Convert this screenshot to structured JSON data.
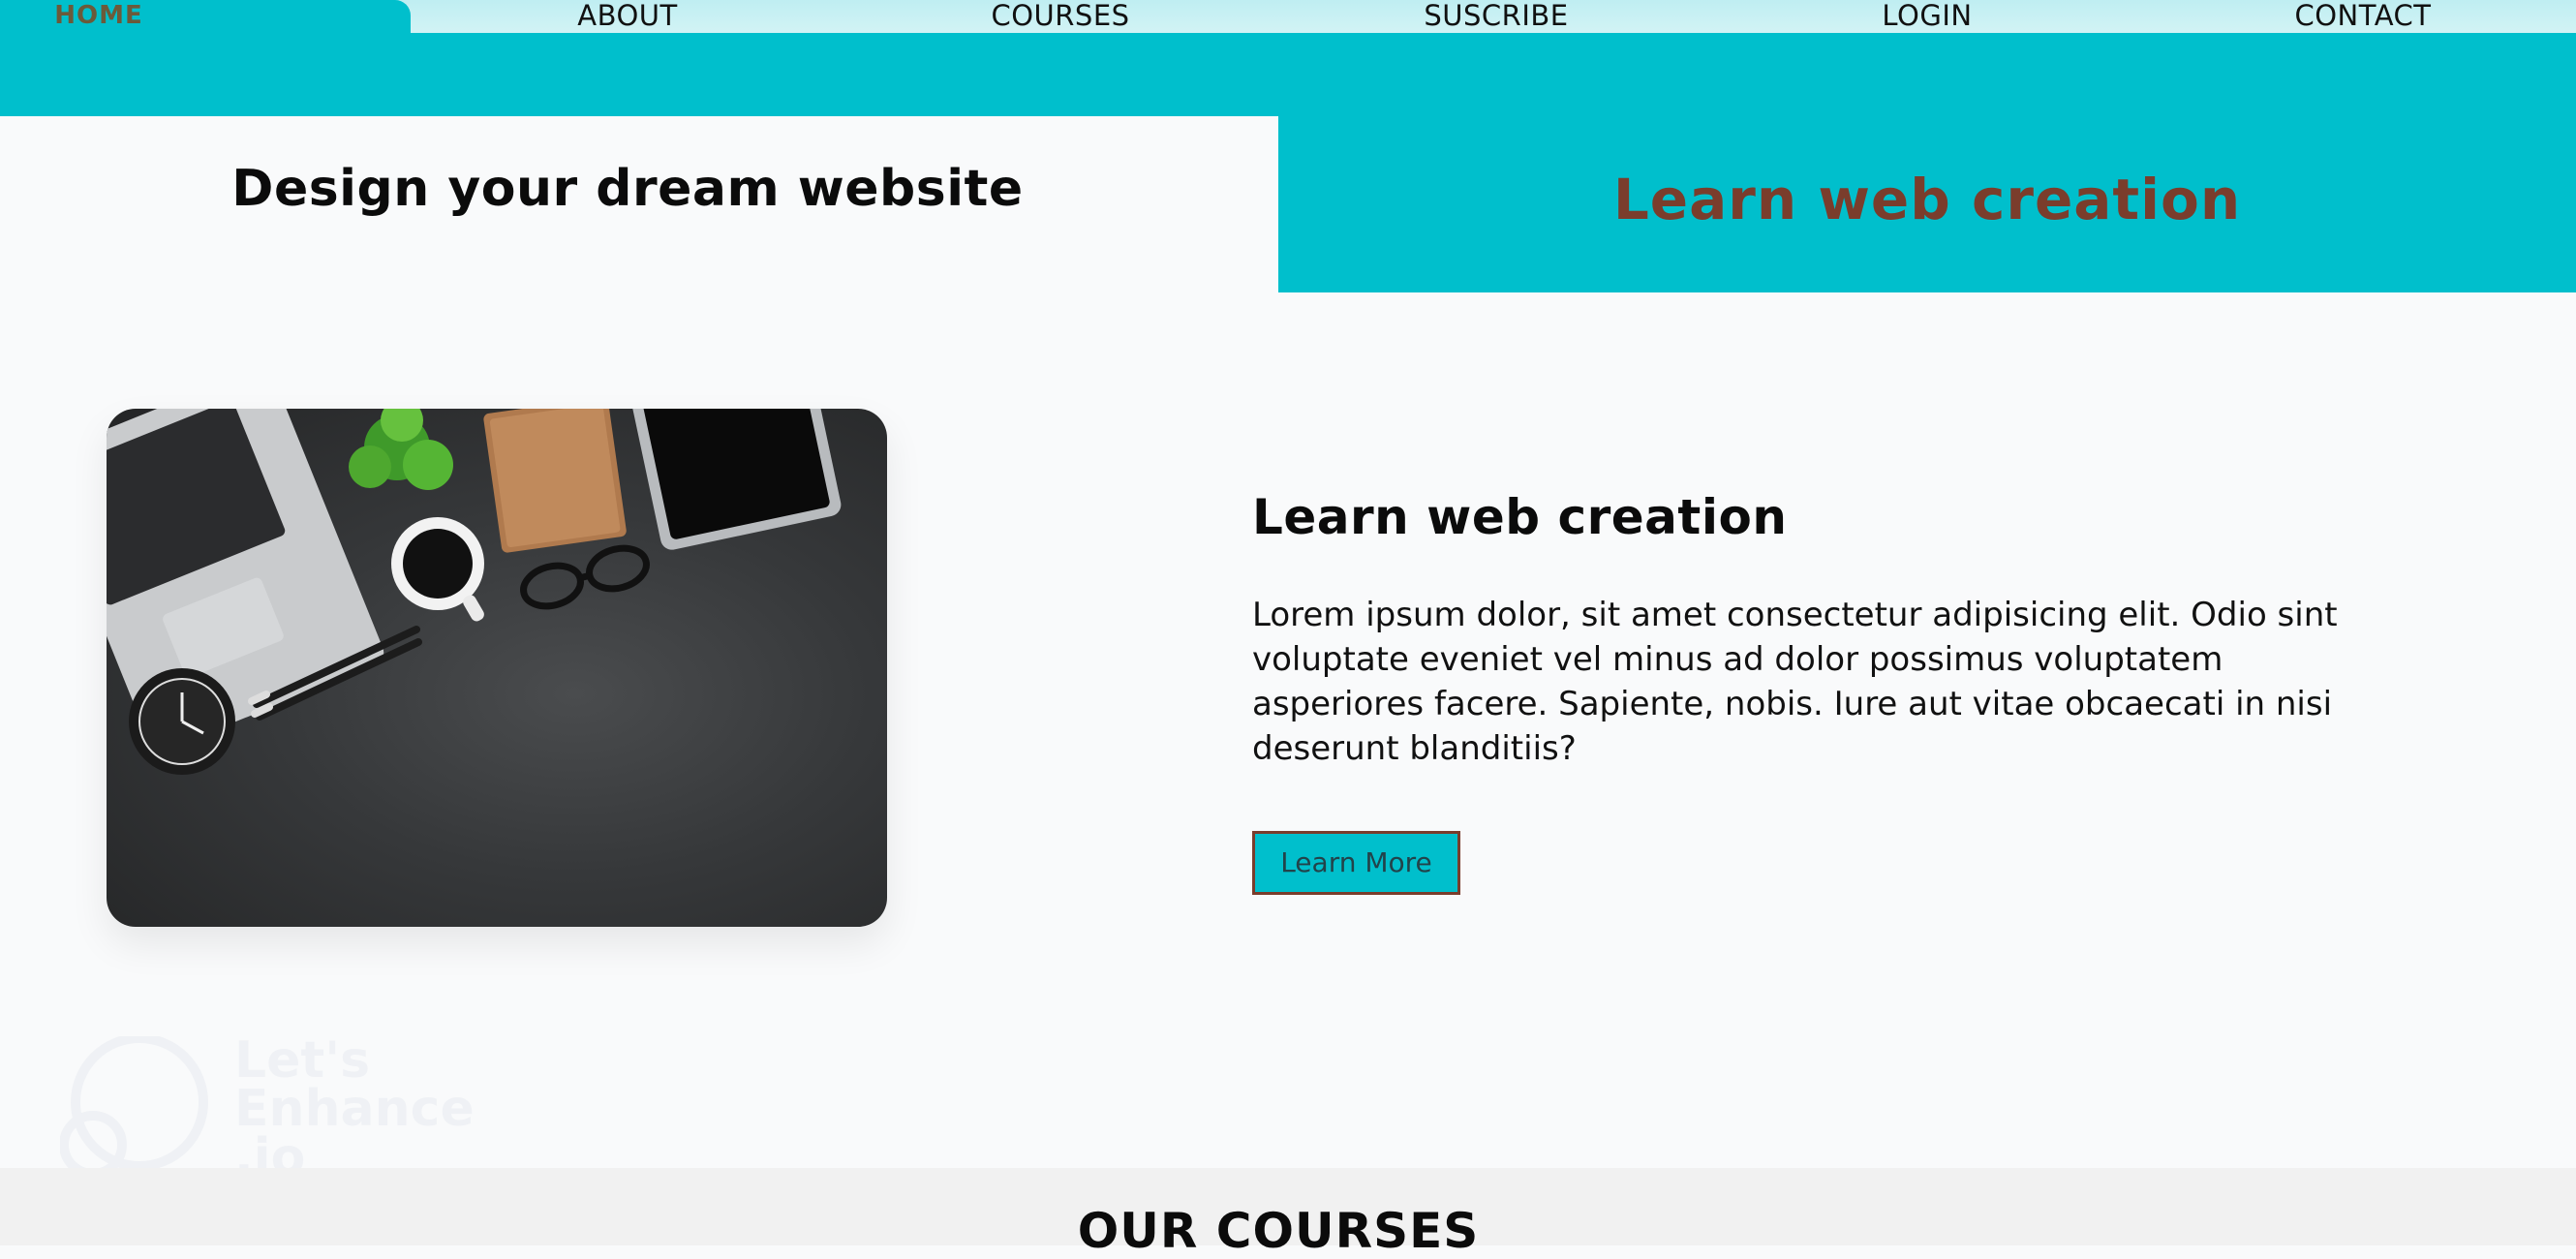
{
  "nav": {
    "items": [
      {
        "label": "HOME"
      },
      {
        "label": "ABOUT"
      },
      {
        "label": "COURSES"
      },
      {
        "label": "SUSCRIBE"
      },
      {
        "label": "LOGIN"
      },
      {
        "label": "CONTACT"
      }
    ],
    "active": "HOME"
  },
  "hero": {
    "left_title": "Design your dream website",
    "right_title": "Learn web creation"
  },
  "feature": {
    "title": "Learn web creation",
    "text": "Lorem ipsum dolor, sit amet consectetur adipisicing elit. Odio sint voluptate eveniet vel minus ad dolor possimus voluptatem asperiores facere. Sapiente, nobis. Iure aut vitae obcaecati in nisi deserunt blanditiis?",
    "button_label": "Learn More",
    "image_alt": "desk with laptop, coffee, plant, notebook, tablet, glasses, pencils and clock"
  },
  "watermark": {
    "text": "Let's\nEnhance\n.io"
  },
  "courses": {
    "title": "OUR COURSES"
  },
  "colors": {
    "accent": "#00bfcc",
    "brand_brown": "#7a3d2c",
    "nav_bg": "#c8f0f3",
    "page_bg": "#f9fafb"
  }
}
